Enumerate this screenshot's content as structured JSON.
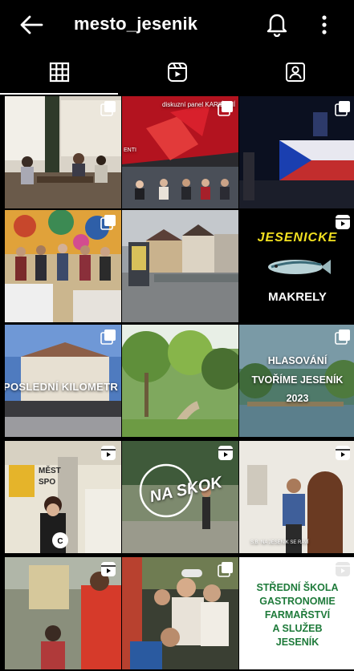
{
  "header": {
    "title": "mesto_jesenik",
    "back_icon": "back-arrow-icon",
    "notify_icon": "bell-icon",
    "menu_icon": "more-vertical-icon"
  },
  "tabs": [
    {
      "name": "posts",
      "icon": "grid-icon",
      "active": true
    },
    {
      "name": "reels",
      "icon": "reels-icon",
      "active": false
    },
    {
      "name": "tagged",
      "icon": "tagged-person-icon",
      "active": false
    }
  ],
  "posts": [
    {
      "id": 1,
      "type": "carousel",
      "scene": "people seated in a room with windows"
    },
    {
      "id": 2,
      "type": "carousel",
      "caption": "diskuzní panel KARIÉRNÍ",
      "sub": "ENTI"
    },
    {
      "id": 3,
      "type": "carousel",
      "scene": "building lit with Czech flag at night"
    },
    {
      "id": 4,
      "type": "carousel",
      "scene": "group photo by colourful wall"
    },
    {
      "id": 5,
      "type": "photo",
      "scene": "town square with historic houses"
    },
    {
      "id": 6,
      "type": "reel",
      "title": "JESENICKE",
      "subtitle": "MAKRELY"
    },
    {
      "id": 7,
      "type": "carousel",
      "caption": "POSLEDNÍ KILOMETR"
    },
    {
      "id": 8,
      "type": "photo",
      "scene": "park path with green trees"
    },
    {
      "id": 9,
      "type": "carousel",
      "line1": "HLASOVÁNÍ",
      "line2": "TVOŘÍME JESENÍK",
      "line3": "2023"
    },
    {
      "id": 10,
      "type": "reel",
      "sign1": "MĚST",
      "sign2": "SPO"
    },
    {
      "id": 11,
      "type": "reel",
      "logo": "NA SKOK"
    },
    {
      "id": 12,
      "type": "reel",
      "caption": "S.B. NA JESENÍK SE RAVÍ"
    },
    {
      "id": 13,
      "type": "reel",
      "scene": "man and child playing outdoors"
    },
    {
      "id": 14,
      "type": "carousel",
      "scene": "girls smiling at festival"
    },
    {
      "id": 15,
      "type": "reel",
      "lines": [
        "STŘEDNÍ ŠKOLA",
        "GASTRONOMIE",
        "FARMAŘSTVÍ",
        "A SLUŽEB",
        "JESENÍK"
      ]
    }
  ]
}
